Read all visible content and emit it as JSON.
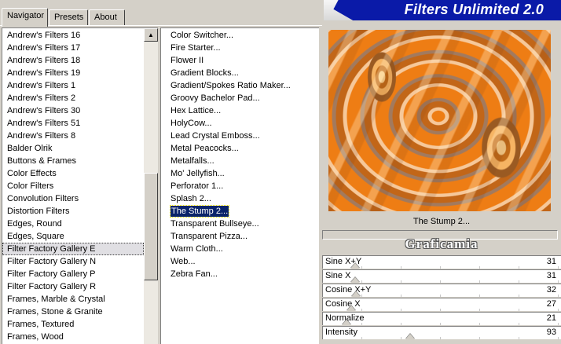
{
  "tabs": [
    {
      "label": "Navigator",
      "active": true
    },
    {
      "label": "Presets",
      "active": false
    },
    {
      "label": "About",
      "active": false
    }
  ],
  "banner": {
    "title": "Filters Unlimited 2.0"
  },
  "categories": {
    "items": [
      "Andrew's Filters 16",
      "Andrew's Filters 17",
      "Andrew's Filters 18",
      "Andrew's Filters 19",
      "Andrew's Filters 1",
      "Andrew's Filters 2",
      "Andrew's Filters 30",
      "Andrew's Filters 51",
      "Andrew's Filters 8",
      "Balder Olrik",
      "Buttons & Frames",
      "Color Effects",
      "Color Filters",
      "Convolution Filters",
      "Distortion Filters",
      "Edges, Round",
      "Edges, Square",
      "Filter Factory Gallery E",
      "Filter Factory Gallery N",
      "Filter Factory Gallery P",
      "Filter Factory Gallery R",
      "Frames, Marble & Crystal",
      "Frames, Stone & Granite",
      "Frames, Textured",
      "Frames, Wood"
    ],
    "selected": "Filter Factory Gallery E"
  },
  "filters": {
    "items": [
      "Color Switcher...",
      "Fire Starter...",
      "Flower II",
      "Gradient Blocks...",
      "Gradient/Spokes Ratio Maker...",
      "Groovy Bachelor Pad...",
      "Hex Lattice...",
      "HolyCow...",
      "Lead Crystal Emboss...",
      "Metal Peacocks...",
      "Metalfalls...",
      "Mo' Jellyfish...",
      "Perforator 1...",
      "Splash 2...",
      "The Stump 2...",
      "Transparent Bullseye...",
      "Transparent Pizza...",
      "Warm Cloth...",
      "Web...",
      "Zebra Fan..."
    ],
    "selected": "The Stump 2..."
  },
  "preview": {
    "label": "The Stump 2...",
    "watermark": "Graficamia"
  },
  "sliders": [
    {
      "label": "Sine X+Y",
      "value": 31,
      "max": 255
    },
    {
      "label": "Sine X",
      "value": 31,
      "max": 255
    },
    {
      "label": "Cosine X+Y",
      "value": 32,
      "max": 255
    },
    {
      "label": "Cosine X",
      "value": 27,
      "max": 255
    },
    {
      "label": "Normalize",
      "value": 21,
      "max": 255
    },
    {
      "label": "Intensity",
      "value": 93,
      "max": 255
    }
  ],
  "colors": {
    "selection": "#0a246a",
    "banner": "#0a1aa8",
    "face": "#d4d0c8"
  }
}
